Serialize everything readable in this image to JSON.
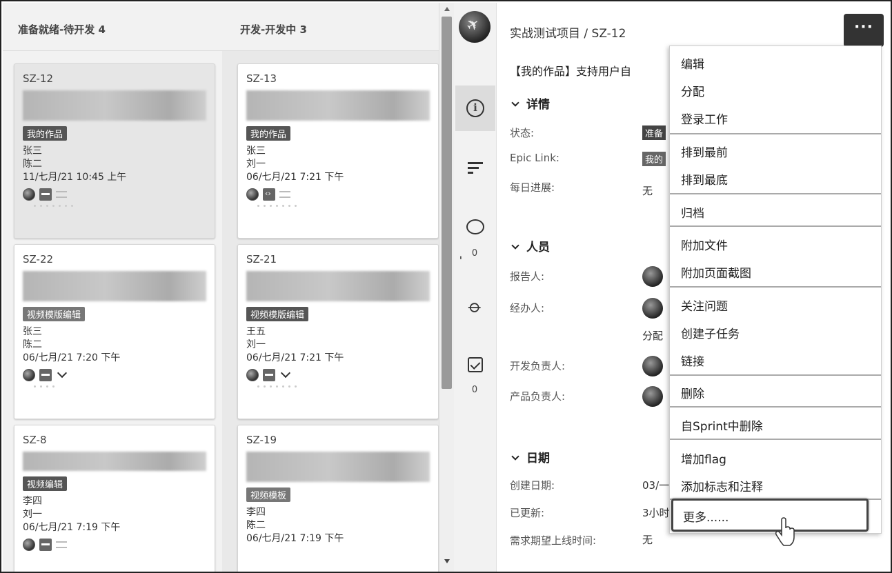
{
  "board": {
    "columns": [
      {
        "title": "准备就绪-待开发 4"
      },
      {
        "title": "开发-开发中 3"
      }
    ],
    "col1_cards": [
      {
        "key": "SZ-12",
        "label": "我的作品",
        "people": [
          "张三",
          "陈二"
        ],
        "date": "11/七月/21 10:45 上午"
      },
      {
        "key": "SZ-22",
        "label": "视频模版编辑",
        "people": [
          "张三",
          "陈二"
        ],
        "date": "06/七月/21 7:20 下午"
      },
      {
        "key": "SZ-8",
        "label": "视频编辑",
        "people": [
          "李四",
          "刘一"
        ],
        "date": "06/七月/21 7:19 下午"
      }
    ],
    "col2_cards": [
      {
        "key": "SZ-13",
        "label": "我的作品",
        "people": [
          "张三",
          "刘一"
        ],
        "date": "06/七月/21 7:21 下午"
      },
      {
        "key": "SZ-21",
        "label": "视频模版编辑",
        "people": [
          "王五",
          "刘一"
        ],
        "date": "06/七月/21 7:21 下午"
      },
      {
        "key": "SZ-19",
        "label": "视频模板",
        "people": [
          "李四",
          "陈二"
        ],
        "date": "06/七月/21 7:19 下午"
      }
    ]
  },
  "rail": {
    "comments_count": "0",
    "subtasks_count": "0"
  },
  "detail": {
    "breadcrumb": "实战测试项目 / SZ-12",
    "more_label": "···",
    "title": "【我的作品】支持用户自",
    "sections": {
      "details": "详情",
      "people": "人员",
      "dates": "日期"
    },
    "fields": {
      "status_label": "状态:",
      "status_value": "准备",
      "epic_label": "Epic Link:",
      "epic_value": "我的",
      "progress_label": "每日进展:",
      "progress_value": "无",
      "reporter_label": "报告人:",
      "assignee_label": "经办人:",
      "assign_link": "分配",
      "dev_owner_label": "开发负责人:",
      "product_owner_label": "产品负责人:",
      "created_label": "创建日期:",
      "created_value": "03/一",
      "updated_label": "已更新:",
      "updated_value": "3小时",
      "launch_label": "需求期望上线时间:",
      "launch_value": "无"
    }
  },
  "menu": {
    "items": [
      "编辑",
      "分配",
      "登录工作",
      "排到最前",
      "排到最底",
      "归档",
      "附加文件",
      "附加页面截图",
      "关注问题",
      "创建子任务",
      "链接",
      "删除",
      "自Sprint中删除",
      "增加flag",
      "添加标志和注释",
      "更多......"
    ]
  }
}
